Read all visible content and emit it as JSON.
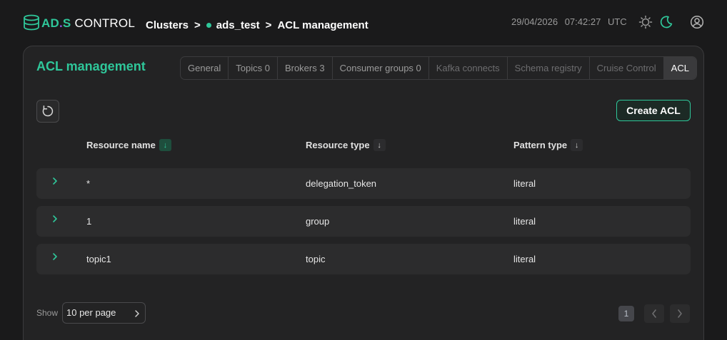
{
  "header": {
    "logo": {
      "ads": "AD",
      "dot": ".",
      "s": "S",
      "control": "CONTROL"
    },
    "breadcrumb": {
      "clusters": "Clusters",
      "sep": ">",
      "cluster": "ads_test",
      "page": "ACL management"
    },
    "date": "29/04/2026",
    "time": "07:42:27",
    "tz": "UTC",
    "icons": [
      "sun-icon",
      "moon-icon",
      "user-icon"
    ]
  },
  "card": {
    "title": "ACL management",
    "tabs": [
      {
        "label": "General",
        "state": "normal"
      },
      {
        "label": "Topics 0",
        "state": "normal"
      },
      {
        "label": "Brokers 3",
        "state": "normal"
      },
      {
        "label": "Consumer groups 0",
        "state": "normal"
      },
      {
        "label": "Kafka connects",
        "state": "disabled"
      },
      {
        "label": "Schema registry",
        "state": "disabled"
      },
      {
        "label": "Cruise Control",
        "state": "disabled"
      },
      {
        "label": "ACL",
        "state": "active"
      }
    ],
    "create_label": "Create ACL",
    "columns": {
      "resource_name": "Resource name",
      "resource_type": "Resource type",
      "pattern_type": "Pattern type",
      "sort_glyph": "↓"
    },
    "rows": [
      {
        "name": "*",
        "type": "delegation_token",
        "pattern": "literal"
      },
      {
        "name": "1",
        "type": "group",
        "pattern": "literal"
      },
      {
        "name": "topic1",
        "type": "topic",
        "pattern": "literal"
      }
    ],
    "pagination": {
      "show_label": "Show",
      "per_page": "10 per page",
      "current_page": "1"
    }
  },
  "colors": {
    "accent": "#2fc79a",
    "brand_purple": "#8a55e0",
    "background": "#1a1a1b",
    "card": "#232324",
    "row": "#2c2c2d"
  }
}
